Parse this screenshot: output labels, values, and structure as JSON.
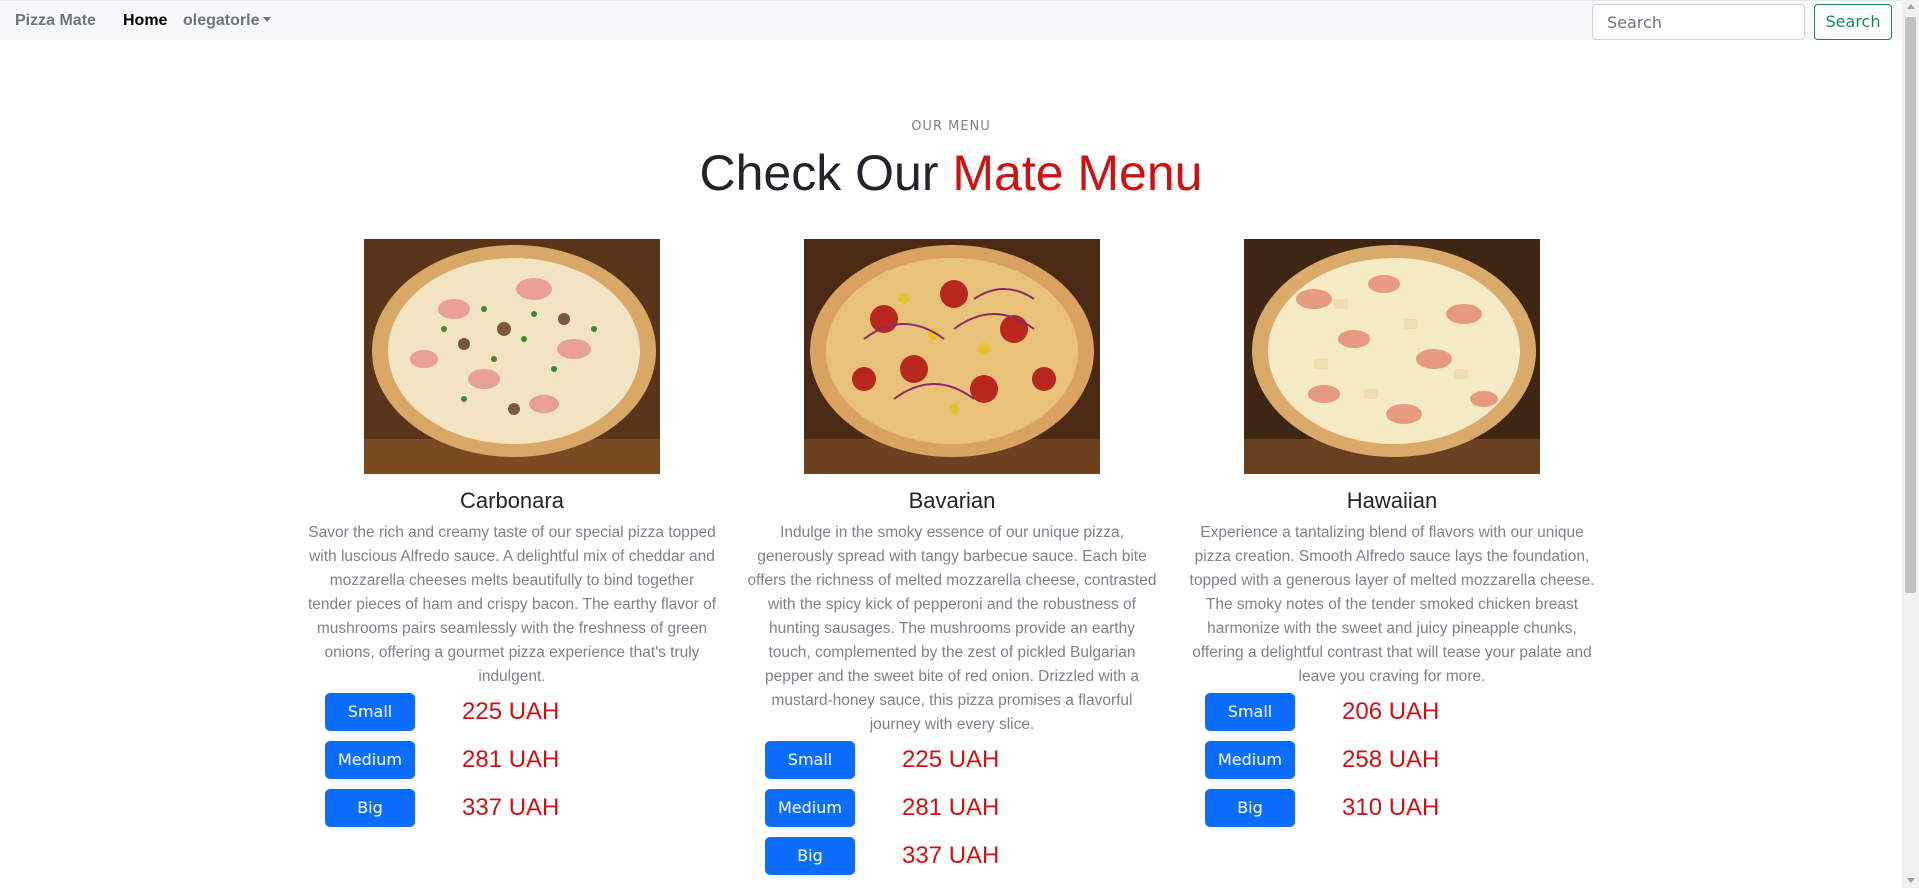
{
  "navbar": {
    "brand": "Pizza Mate",
    "home": "Home",
    "user": "olegatorle",
    "search_placeholder": "Search",
    "search_button": "Search"
  },
  "section": {
    "subtitle": "OUR MENU",
    "title_prefix": "Check Our ",
    "title_accent": "Mate Menu"
  },
  "pizzas": [
    {
      "name": "Carbonara",
      "description": "Savor the rich and creamy taste of our special pizza topped with luscious Alfredo sauce. A delightful mix of cheddar and mozzarella cheeses melts beautifully to bind together tender pieces of ham and crispy bacon. The earthy flavor of mushrooms pairs seamlessly with the freshness of green onions, offering a gourmet pizza experience that's truly indulgent.",
      "sizes": [
        {
          "label": "Small",
          "price": "225 UAH"
        },
        {
          "label": "Medium",
          "price": "281 UAH"
        },
        {
          "label": "Big",
          "price": "337 UAH"
        }
      ]
    },
    {
      "name": "Bavarian",
      "description": "Indulge in the smoky essence of our unique pizza, generously spread with tangy barbecue sauce. Each bite offers the richness of melted mozzarella cheese, contrasted with the spicy kick of pepperoni and the robustness of hunting sausages. The mushrooms provide an earthy touch, complemented by the zest of pickled Bulgarian pepper and the sweet bite of red onion. Drizzled with a mustard-honey sauce, this pizza promises a flavorful journey with every slice.",
      "sizes": [
        {
          "label": "Small",
          "price": "225 UAH"
        },
        {
          "label": "Medium",
          "price": "281 UAH"
        },
        {
          "label": "Big",
          "price": "337 UAH"
        }
      ]
    },
    {
      "name": "Hawaiian",
      "description": "Experience a tantalizing blend of flavors with our unique pizza creation. Smooth Alfredo sauce lays the foundation, topped with a generous layer of melted mozzarella cheese. The smoky notes of the tender smoked chicken breast harmonize with the sweet and juicy pineapple chunks, offering a delightful contrast that will tease your palate and leave you craving for more.",
      "sizes": [
        {
          "label": "Small",
          "price": "206 UAH"
        },
        {
          "label": "Medium",
          "price": "258 UAH"
        },
        {
          "label": "Big",
          "price": "310 UAH"
        }
      ]
    }
  ],
  "colors": {
    "accent": "#ce1212",
    "button": "#0d6efd",
    "search_button": "#198754"
  }
}
